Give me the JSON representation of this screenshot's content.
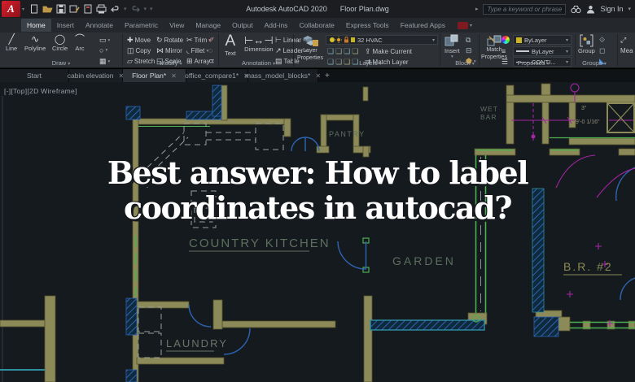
{
  "titlebar": {
    "app_title": "Autodesk AutoCAD 2020",
    "doc_title": "Floor Plan.dwg",
    "search_placeholder": "Type a keyword or phrase",
    "sign_in": "Sign In"
  },
  "ribbon": {
    "tabs": [
      "Home",
      "Insert",
      "Annotate",
      "Parametric",
      "View",
      "Manage",
      "Output",
      "Add-ins",
      "Collaborate",
      "Express Tools",
      "Featured Apps"
    ],
    "active_tab": "Home",
    "draw": {
      "label": "Draw",
      "tools": [
        "Line",
        "Polyline",
        "Circle",
        "Arc"
      ]
    },
    "modify": {
      "label": "Modify",
      "tools": [
        "Move",
        "Rotate",
        "Trim",
        "Copy",
        "Mirror",
        "Fillet",
        "Stretch",
        "Scale",
        "Array"
      ]
    },
    "annotation": {
      "label": "Annotation",
      "text_tool": "Text",
      "dimension_tool": "Dimension",
      "tools": [
        "Linear",
        "Leader",
        "Table"
      ]
    },
    "layers": {
      "label": "Layers",
      "layer_properties": "Layer Properties",
      "current_layer": "32 HVAC",
      "make_current": "Make Current",
      "match_layer": "Match Layer"
    },
    "block": {
      "label": "Block",
      "insert": "Insert"
    },
    "properties": {
      "label": "Properties",
      "match_properties": "Match Properties",
      "color": "ByLayer",
      "lineweight": "ByLayer",
      "linetype": "CONTI..."
    },
    "groups": {
      "label": "Groups",
      "group": "Group"
    },
    "utilities": {
      "measure": "Mea"
    }
  },
  "file_tabs": {
    "tabs": [
      "Start",
      "cabin elevation",
      "Floor Plan*",
      "office_compare1*",
      "mass_model_blocks*"
    ],
    "active": "Floor Plan*",
    "new_tab": "+"
  },
  "viewport": {
    "controls": "[-][Top][2D Wireframe]"
  },
  "plan": {
    "labels": {
      "pantry": "PANTRY",
      "kitchen": "COUNTRY KITCHEN",
      "garden": "GARDEN",
      "bedroom": "B.R. #2",
      "laundry": "LAUNDRY",
      "wet": "WET",
      "bar": "BAR"
    },
    "dims": {
      "main": "9'-0 1/16\"",
      "small": "3\""
    }
  },
  "overlay": {
    "line1": "Best answer: How to label",
    "line2": "coordinates in autocad?"
  },
  "colors": {
    "wall_khaki": "#8C8A58",
    "window_green": "#4CAF50",
    "hatch_blue": "#2E64B4",
    "door_blue": "#2E64B4",
    "magenta": "#A426A4",
    "teal": "#2E8FA3",
    "logo_red": "#C01722",
    "layer_yellow": "#C8B424"
  }
}
